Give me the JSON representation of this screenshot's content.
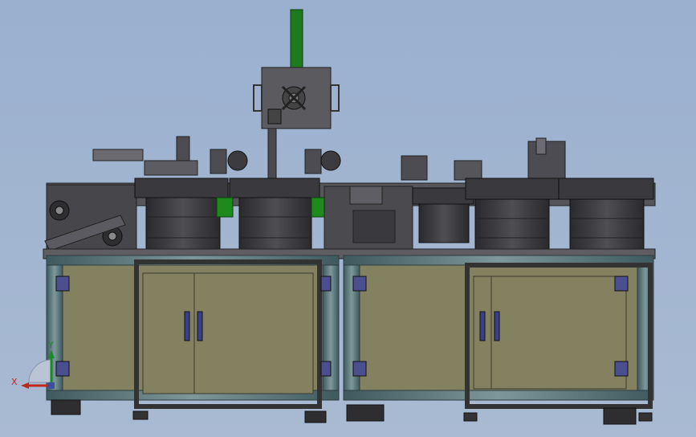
{
  "viewport": {
    "background_top": "#9ab0cf",
    "background_bottom": "#a9bad2"
  },
  "triad": {
    "x_label": "X",
    "y_label": "Y",
    "x_color": "#c0281d",
    "y_color": "#1a8a2a"
  },
  "colors": {
    "frame": "#536f74",
    "frame_dark": "#2e3c3f",
    "panel": "#838160",
    "panel_dark": "#5e5c44",
    "machine": "#4c4c50",
    "machine_dark": "#2b2b2e",
    "machine_light": "#7a7a80",
    "green": "#1e7a1e",
    "handle": "#3a3f8a",
    "hinge": "#4b4f8f"
  }
}
